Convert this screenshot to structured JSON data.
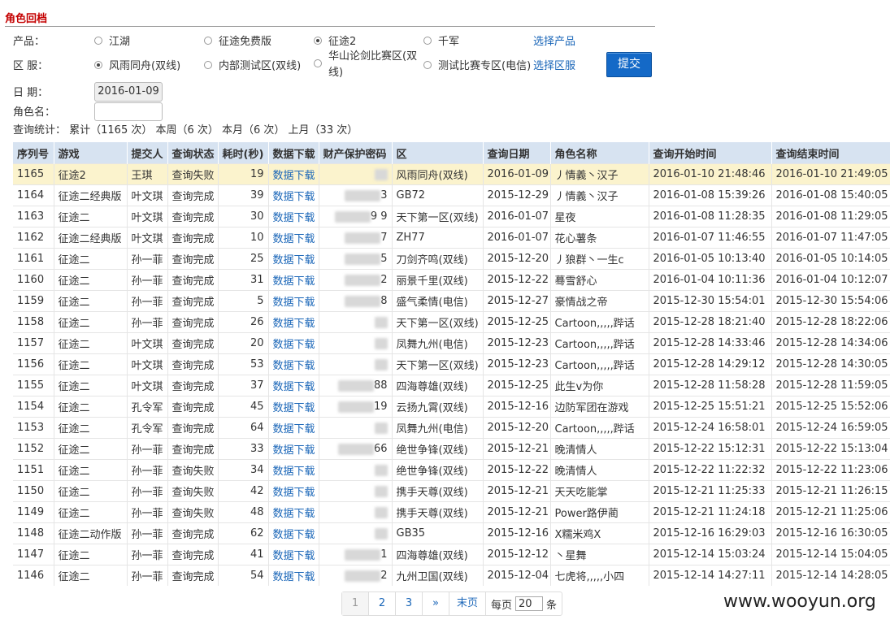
{
  "section_title": "角色回档",
  "form": {
    "product_label": "产品：",
    "products": [
      {
        "label": "江湖",
        "selected": false
      },
      {
        "label": "征途免费版",
        "selected": false
      },
      {
        "label": "征途2",
        "selected": true
      },
      {
        "label": "千军",
        "selected": false
      }
    ],
    "choose_product": "选择产品",
    "server_label": "区  服：",
    "servers": [
      {
        "label": "风雨同舟(双线)",
        "selected": true
      },
      {
        "label": "内部测试区(双线)",
        "selected": false
      },
      {
        "label": "华山论剑比赛区(双线)",
        "selected": false
      },
      {
        "label": "测试比赛专区(电信)",
        "selected": false
      }
    ],
    "choose_server": "选择区服",
    "submit_label": "提交",
    "date_label": "日  期：",
    "date_value": "2016-01-09",
    "role_label": "角色名：",
    "role_value": ""
  },
  "stats": "查询统计： 累计（1165 次） 本周（6 次） 本月（6 次） 上月（33 次）",
  "table": {
    "headers": [
      "序列号",
      "游戏",
      "提交人",
      "查询状态",
      "耗时(秒)",
      "数据下载",
      "财产保护密码",
      "区",
      "查询日期",
      "角色名称",
      "查询开始时间",
      "查询结束时间"
    ],
    "rows": [
      {
        "id": "1165",
        "game": "征途2",
        "user": "王琪",
        "status": "查询失败",
        "secs": "19",
        "dl": "数据下载",
        "pwd": "",
        "zone": "风雨同舟(双线)",
        "date": "2016-01-09",
        "role": "丿情義丶汉子",
        "start": "2016-01-10 21:48:46",
        "end": "2016-01-10 21:49:05"
      },
      {
        "id": "1164",
        "game": "征途二经典版",
        "user": "叶文琪",
        "status": "查询完成",
        "secs": "39",
        "dl": "数据下载",
        "pwd": "3",
        "zone": "GB72",
        "date": "2015-12-29",
        "role": "丿情義丶汉子",
        "start": "2016-01-08 15:39:26",
        "end": "2016-01-08 15:40:05"
      },
      {
        "id": "1163",
        "game": "征途二",
        "user": "叶文琪",
        "status": "查询完成",
        "secs": "30",
        "dl": "数据下载",
        "pwd": "9  9",
        "zone": "天下第一区(双线)",
        "date": "2016-01-07",
        "role": "星夜",
        "start": "2016-01-08 11:28:35",
        "end": "2016-01-08 11:29:05"
      },
      {
        "id": "1162",
        "game": "征途二经典版",
        "user": "叶文琪",
        "status": "查询完成",
        "secs": "10",
        "dl": "数据下载",
        "pwd": "7",
        "zone": "ZH77",
        "date": "2016-01-07",
        "role": "花心薯条",
        "start": "2016-01-07 11:46:55",
        "end": "2016-01-07 11:47:05"
      },
      {
        "id": "1161",
        "game": "征途二",
        "user": "孙一菲",
        "status": "查询完成",
        "secs": "25",
        "dl": "数据下载",
        "pwd": "5",
        "zone": "刀剑齐鸣(双线)",
        "date": "2015-12-20",
        "role": "丿狼群丶一生c",
        "start": "2016-01-05 10:13:40",
        "end": "2016-01-05 10:14:05"
      },
      {
        "id": "1160",
        "game": "征途二",
        "user": "孙一菲",
        "status": "查询完成",
        "secs": "31",
        "dl": "数据下载",
        "pwd": "2",
        "zone": "丽景千里(双线)",
        "date": "2015-12-22",
        "role": "蓦雪舒心",
        "start": "2016-01-04 10:11:36",
        "end": "2016-01-04 10:12:07"
      },
      {
        "id": "1159",
        "game": "征途二",
        "user": "孙一菲",
        "status": "查询完成",
        "secs": "5",
        "dl": "数据下载",
        "pwd": "8",
        "zone": "盛气柔情(电信)",
        "date": "2015-12-27",
        "role": "豪情战之帝",
        "start": "2015-12-30 15:54:01",
        "end": "2015-12-30 15:54:06"
      },
      {
        "id": "1158",
        "game": "征途二",
        "user": "孙一菲",
        "status": "查询完成",
        "secs": "26",
        "dl": "数据下载",
        "pwd": "",
        "zone": "天下第一区(双线)",
        "date": "2015-12-25",
        "role": "Cartoon,,,,,跸话",
        "start": "2015-12-28 18:21:40",
        "end": "2015-12-28 18:22:06"
      },
      {
        "id": "1157",
        "game": "征途二",
        "user": "叶文琪",
        "status": "查询完成",
        "secs": "20",
        "dl": "数据下载",
        "pwd": "",
        "zone": "凤舞九州(电信)",
        "date": "2015-12-23",
        "role": "Cartoon,,,,,跸话",
        "start": "2015-12-28 14:33:46",
        "end": "2015-12-28 14:34:06"
      },
      {
        "id": "1156",
        "game": "征途二",
        "user": "叶文琪",
        "status": "查询完成",
        "secs": "53",
        "dl": "数据下载",
        "pwd": "",
        "zone": "天下第一区(双线)",
        "date": "2015-12-23",
        "role": "Cartoon,,,,,跸话",
        "start": "2015-12-28 14:29:12",
        "end": "2015-12-28 14:30:05"
      },
      {
        "id": "1155",
        "game": "征途二",
        "user": "叶文琪",
        "status": "查询完成",
        "secs": "37",
        "dl": "数据下载",
        "pwd": "88",
        "zone": "四海尊雄(双线)",
        "date": "2015-12-25",
        "role": "此生v为你",
        "start": "2015-12-28 11:58:28",
        "end": "2015-12-28 11:59:05"
      },
      {
        "id": "1154",
        "game": "征途二",
        "user": "孔令军",
        "status": "查询完成",
        "secs": "45",
        "dl": "数据下载",
        "pwd": "19",
        "zone": "云扬九霄(双线)",
        "date": "2015-12-16",
        "role": "边防军团在游戏",
        "start": "2015-12-25 15:51:21",
        "end": "2015-12-25 15:52:06"
      },
      {
        "id": "1153",
        "game": "征途二",
        "user": "孔令军",
        "status": "查询完成",
        "secs": "64",
        "dl": "数据下载",
        "pwd": "",
        "zone": "凤舞九州(电信)",
        "date": "2015-12-20",
        "role": "Cartoon,,,,,跸话",
        "start": "2015-12-24 16:58:01",
        "end": "2015-12-24 16:59:05"
      },
      {
        "id": "1152",
        "game": "征途二",
        "user": "孙一菲",
        "status": "查询完成",
        "secs": "33",
        "dl": "数据下载",
        "pwd": "66",
        "zone": "绝世争锋(双线)",
        "date": "2015-12-21",
        "role": "晚清情人",
        "start": "2015-12-22 15:12:31",
        "end": "2015-12-22 15:13:04"
      },
      {
        "id": "1151",
        "game": "征途二",
        "user": "孙一菲",
        "status": "查询失败",
        "secs": "34",
        "dl": "数据下载",
        "pwd": "",
        "zone": "绝世争锋(双线)",
        "date": "2015-12-22",
        "role": "晚清情人",
        "start": "2015-12-22 11:22:32",
        "end": "2015-12-22 11:23:06"
      },
      {
        "id": "1150",
        "game": "征途二",
        "user": "孙一菲",
        "status": "查询失败",
        "secs": "42",
        "dl": "数据下载",
        "pwd": "",
        "zone": "携手天尊(双线)",
        "date": "2015-12-21",
        "role": "天天吃能掌",
        "start": "2015-12-21 11:25:33",
        "end": "2015-12-21 11:26:15"
      },
      {
        "id": "1149",
        "game": "征途二",
        "user": "孙一菲",
        "status": "查询失败",
        "secs": "48",
        "dl": "数据下载",
        "pwd": "",
        "zone": "携手天尊(双线)",
        "date": "2015-12-21",
        "role": "Power路伊蔺",
        "start": "2015-12-21 11:24:18",
        "end": "2015-12-21 11:25:06"
      },
      {
        "id": "1148",
        "game": "征途二动作版",
        "user": "孙一菲",
        "status": "查询完成",
        "secs": "62",
        "dl": "数据下载",
        "pwd": "",
        "zone": "GB35",
        "date": "2015-12-16",
        "role": "X糯米鸡X",
        "start": "2015-12-16 16:29:03",
        "end": "2015-12-16 16:30:05"
      },
      {
        "id": "1147",
        "game": "征途二",
        "user": "孙一菲",
        "status": "查询完成",
        "secs": "41",
        "dl": "数据下载",
        "pwd": "1",
        "zone": "四海尊雄(双线)",
        "date": "2015-12-12",
        "role": "丶星舞",
        "start": "2015-12-14 15:03:24",
        "end": "2015-12-14 15:04:05"
      },
      {
        "id": "1146",
        "game": "征途二",
        "user": "孙一菲",
        "status": "查询完成",
        "secs": "54",
        "dl": "数据下载",
        "pwd": "2",
        "zone": "九州卫国(双线)",
        "date": "2015-12-04",
        "role": "七虎将,,,,,小四",
        "start": "2015-12-14 14:27:11",
        "end": "2015-12-14 14:28:05"
      }
    ]
  },
  "pager": {
    "pages": [
      "1",
      "2",
      "3"
    ],
    "next": "»",
    "last": "末页",
    "per_page_label": "每页",
    "per_page_value": "20",
    "per_page_unit": "条"
  },
  "watermark": "www.wooyun.org",
  "colors": {
    "accent": "#1469c7",
    "title": "#c40000",
    "header_bg": "#d7e3f1",
    "highlight_row": "#fbf3cd",
    "link": "#1a66b8"
  }
}
